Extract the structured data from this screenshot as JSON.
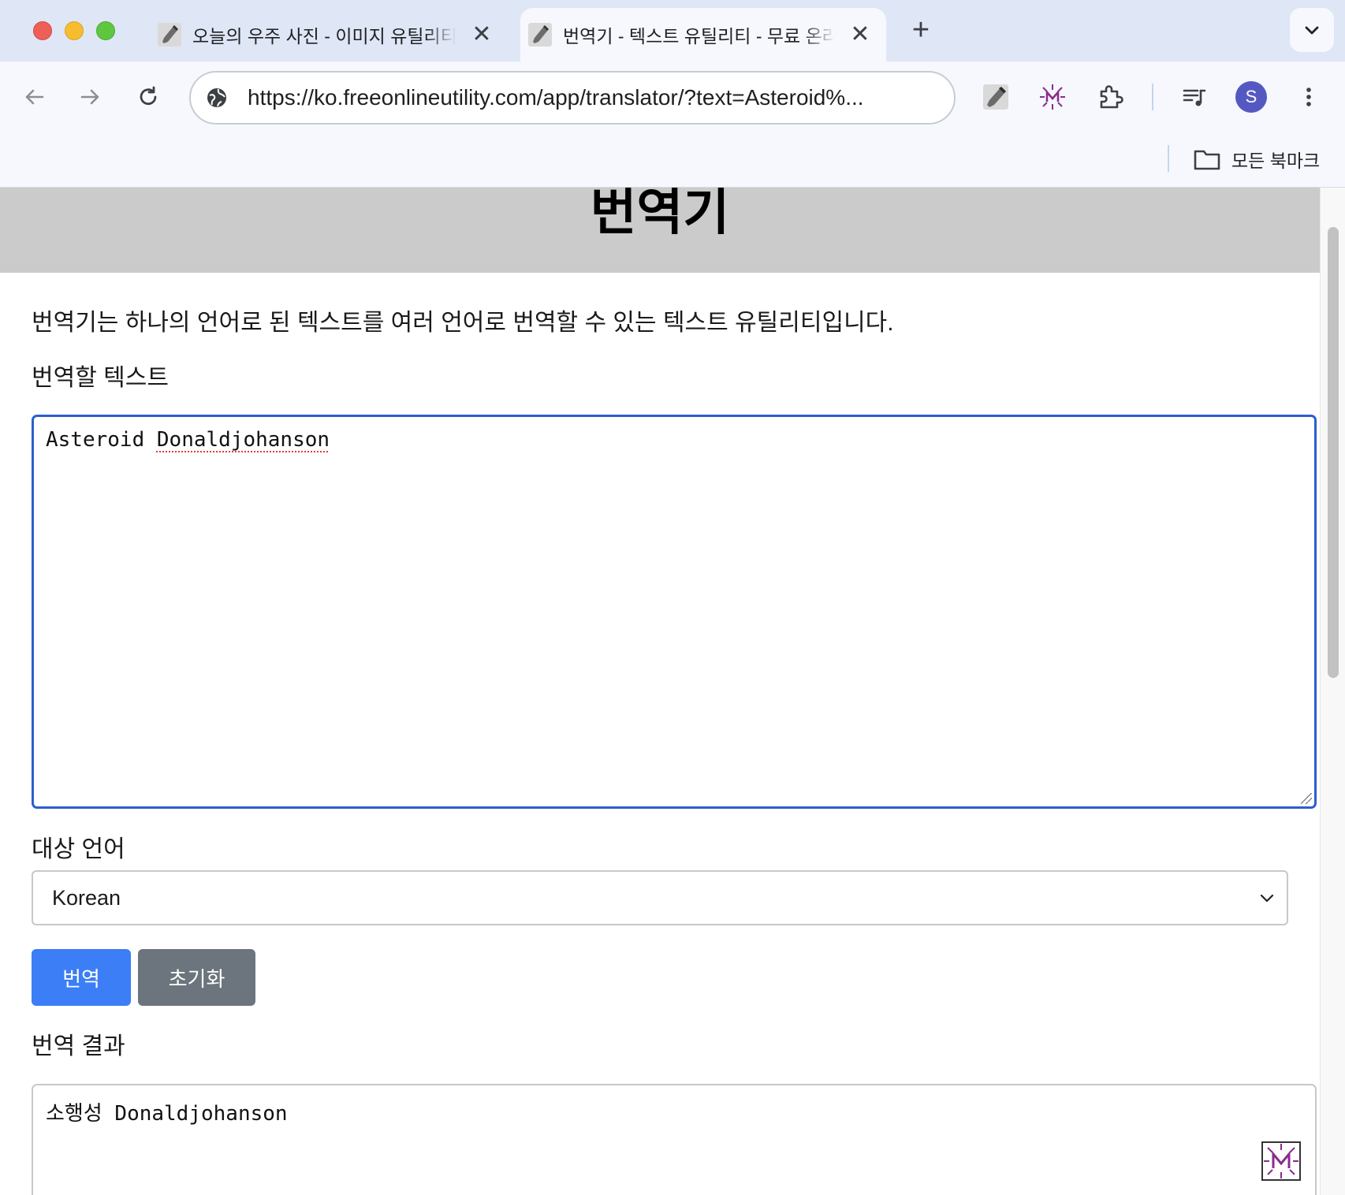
{
  "browser": {
    "tabs": [
      {
        "title": "오늘의 우주 사진 - 이미지 유틸리티 - 무료 온라인 유틸리티",
        "active": false,
        "close": "✕"
      },
      {
        "title": "번역기 - 텍스트 유틸리티 - 무료 온라인 유틸리티",
        "active": true,
        "close": "✕"
      }
    ],
    "new_tab": "+",
    "url": "https://ko.freeonlineutility.com/app/translator/?text=Asteroid%...",
    "profile_initial": "S",
    "bookmarks": {
      "all_bookmarks": "모든 북마크"
    },
    "icons": [
      "back-icon",
      "forward-icon",
      "reload-icon",
      "site-info-icon",
      "extension-wrench-icon",
      "extension-m-icon",
      "extensions-puzzle-icon",
      "media-queue-icon",
      "more-menu-icon",
      "tab-search-chevron-icon",
      "folder-icon"
    ],
    "accent": "#2c5fcd"
  },
  "page": {
    "title": "번역기",
    "intro": "번역기는 하나의 언어로 된 텍스트를 여러 언어로 번역할 수 있는 텍스트 유틸리티입니다.",
    "input_label": "번역할 텍스트",
    "input_value_word1": "Asteroid",
    "input_value_word2": "Donaldjohanson",
    "target_label": "대상 언어",
    "target_language": "Korean",
    "translate_button": "번역",
    "reset_button": "초기화",
    "result_label": "번역 결과",
    "result_value": "소행성 Donaldjohanson",
    "colors": {
      "primary_button": "#3b7ef6",
      "secondary_button": "#6c757d",
      "header_band": "#cbcbcb"
    }
  }
}
